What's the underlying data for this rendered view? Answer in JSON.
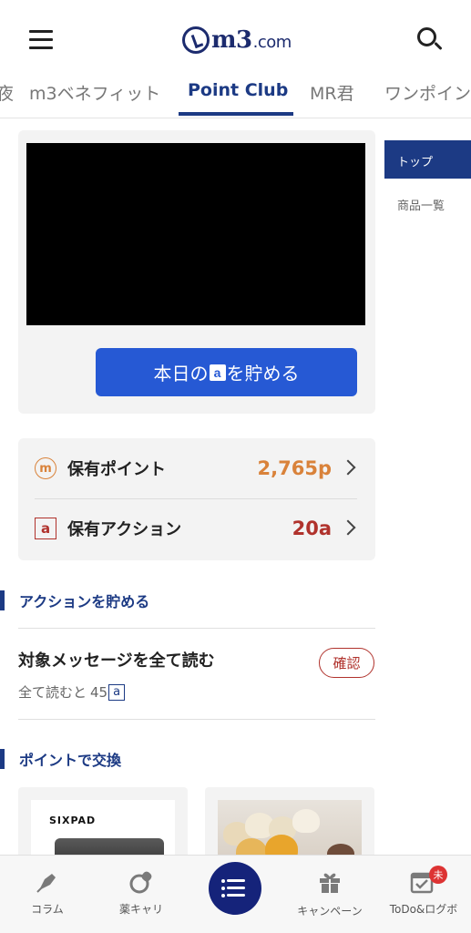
{
  "header": {
    "logo_text": "m3",
    "logo_suffix": ".com"
  },
  "tabs": [
    {
      "label": "夜"
    },
    {
      "label": "m3ベネフィット"
    },
    {
      "label": "Point Club"
    },
    {
      "label": "MR君"
    },
    {
      "label": "ワンポイン"
    }
  ],
  "hero": {
    "cta_prefix": "本日の",
    "cta_icon": "a",
    "cta_suffix": "を貯める"
  },
  "side_nav": {
    "top": "トップ",
    "products": "商品一覧"
  },
  "points": {
    "owned_points_label": "保有ポイント",
    "owned_points_icon": "m",
    "owned_points_value": "2,765p",
    "owned_points_color": "#d9823a",
    "owned_actions_label": "保有アクション",
    "owned_actions_icon": "a",
    "owned_actions_value": "20a",
    "owned_actions_color": "#b0322c"
  },
  "sections": {
    "collect_actions": "アクションを貯める",
    "exchange_points": "ポイントで交換"
  },
  "task": {
    "title": "対象メッセージを全て読む",
    "sub_prefix": "全て読むと",
    "sub_value": "45",
    "sub_icon": "a",
    "confirm_label": "確認"
  },
  "products": {
    "item1_brand": "SIXPAD"
  },
  "bottom_nav": {
    "column": "コラム",
    "career": "薬キャリ",
    "campaign": "キャンペーン",
    "todo": "ToDo&ログボ",
    "todo_badge": "未"
  },
  "colors": {
    "primary": "#1c3a84",
    "cta": "#2659d4",
    "accent_red": "#b0322c",
    "accent_orange": "#d9823a"
  }
}
